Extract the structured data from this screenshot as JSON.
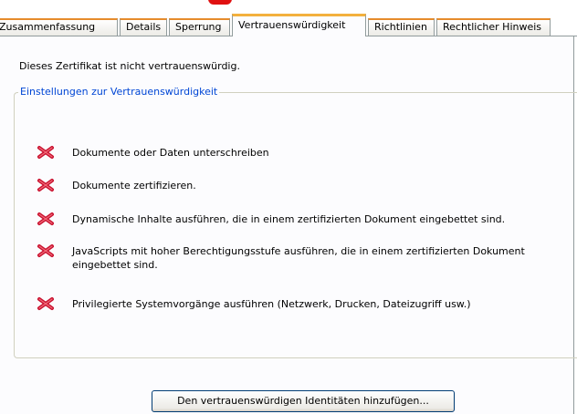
{
  "tabs": [
    {
      "label": "Zusammenfassung",
      "active": false
    },
    {
      "label": "Details",
      "active": false
    },
    {
      "label": "Sperrung",
      "active": false
    },
    {
      "label": "Vertrauenswürdigkeit",
      "active": true
    },
    {
      "label": "Richtlinien",
      "active": false
    },
    {
      "label": "Rechtlicher Hinweis",
      "active": false
    }
  ],
  "status_text": "Dieses Zertifikat ist nicht vertrauenswürdig.",
  "trust_group": {
    "title": "Einstellungen zur Vertrauenswürdigkeit",
    "items": [
      {
        "label": "Dokumente oder Daten unterschreiben",
        "icon": "denied-x-icon"
      },
      {
        "label": "Dokumente zertifizieren.",
        "icon": "denied-x-icon"
      },
      {
        "label": "Dynamische Inhalte ausführen, die in einem zertifizierten Dokument eingebettet sind.",
        "icon": "denied-x-icon"
      },
      {
        "label": "JavaScripts mit hoher Berechtigungsstufe ausführen, die in einem zertifizierten Dokument eingebettet sind.",
        "icon": "denied-x-icon"
      },
      {
        "label": "Privilegierte Systemvorgänge ausführen (Netzwerk, Drucken, Dateizugriff usw.)",
        "icon": "denied-x-icon"
      }
    ]
  },
  "add_button_label": "Den vertrauenswürdigen Identitäten hinzufügen...",
  "colors": {
    "accent_orange": "#f3b03d",
    "legend_blue": "#0046d5",
    "denied_red": "#c8102e"
  }
}
